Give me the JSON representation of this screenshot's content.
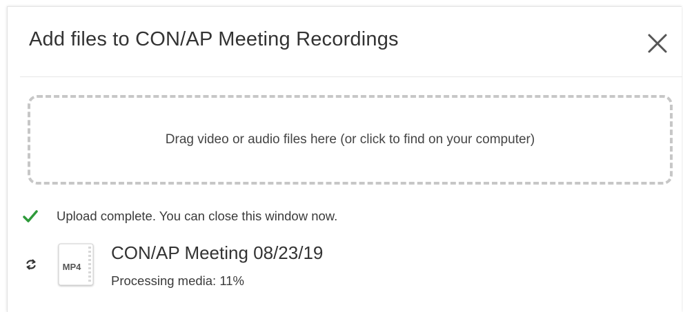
{
  "dialog": {
    "title": "Add files to CON/AP Meeting Recordings",
    "close_icon": "close-icon"
  },
  "dropzone": {
    "text": "Drag video or audio files here (or click to find on your computer)"
  },
  "status": {
    "icon": "check-icon",
    "icon_color": "#2e9a3a",
    "message": "Upload complete. You can close this window now."
  },
  "file": {
    "type_label": "MP4",
    "name": "CON/AP Meeting 08/23/19",
    "status_label": "Processing media:",
    "progress_percent": "11%",
    "progress_value": 0.11,
    "action_icon": "refresh-icon"
  },
  "colors": {
    "text_primary": "#333333",
    "dropzone_border": "#c7c7c7",
    "check_green": "#2e9a3a"
  }
}
